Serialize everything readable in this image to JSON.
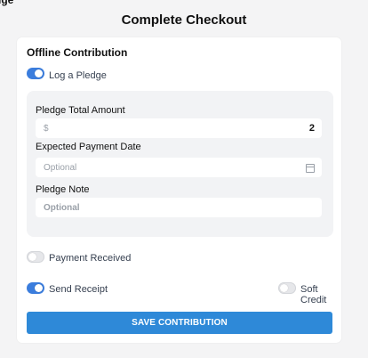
{
  "corner_clip": "dge",
  "page_title": "Complete Checkout",
  "offline": {
    "section_title": "Offline Contribution",
    "log_pledge": {
      "label": "Log a Pledge",
      "on": true
    },
    "pledge_total": {
      "label": "Pledge Total Amount",
      "placeholder": "$",
      "value": "2"
    },
    "expected_date": {
      "label": "Expected Payment Date",
      "placeholder": "Optional"
    },
    "pledge_note": {
      "label": "Pledge Note",
      "placeholder": "Optional"
    },
    "payment_received": {
      "label": "Payment Received",
      "on": false
    },
    "send_receipt": {
      "label": "Send Receipt",
      "on": true
    },
    "soft_credit": {
      "label": "Soft Credit",
      "on": false
    },
    "save_label": "SAVE CONTRIBUTION"
  },
  "colors": {
    "accent": "#2e89d8",
    "toggle_on": "#3b7ddd"
  },
  "icons": {
    "date_field": "calendar-icon"
  }
}
